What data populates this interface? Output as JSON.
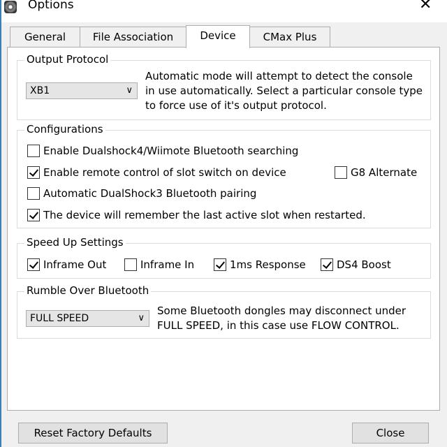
{
  "window": {
    "title": "Options",
    "app_icon": "gear-icon",
    "close_icon": "close-icon"
  },
  "tabs": [
    {
      "label": "General",
      "active": false
    },
    {
      "label": "File Association",
      "active": false
    },
    {
      "label": "Device",
      "active": true
    },
    {
      "label": "CMax Plus",
      "active": false
    }
  ],
  "output_protocol": {
    "title": "Output Protocol",
    "selected": "XB1",
    "description": "Automatic mode will attempt to detect the console in use automatically. Select a particular console type to force use of it's output protocol."
  },
  "configurations": {
    "title": "Configurations",
    "items": [
      {
        "label": "Enable Dualshock4/Wiimote Bluetooth searching",
        "checked": false
      },
      {
        "label": "Enable remote control of slot switch on device",
        "checked": true
      },
      {
        "label": "G8 Alternate",
        "checked": false
      },
      {
        "label": "Automatic DualShock3 Bluetooth pairing",
        "checked": false
      },
      {
        "label": "The device will remember the last active slot when restarted.",
        "checked": true
      }
    ]
  },
  "speed_up": {
    "title": "Speed Up Settings",
    "items": [
      {
        "label": "Inframe Out",
        "checked": true
      },
      {
        "label": "Inframe In",
        "checked": false
      },
      {
        "label": "1ms Response",
        "checked": true
      },
      {
        "label": "DS4 Boost",
        "checked": true
      }
    ]
  },
  "rumble": {
    "title": "Rumble Over Bluetooth",
    "selected": "FULL SPEED",
    "description": "Some Bluetooth dongles may disconnect under FULL SPEED, in this case use FLOW CONTROL."
  },
  "buttons": {
    "reset": "Reset Factory Defaults",
    "close": "Close"
  }
}
